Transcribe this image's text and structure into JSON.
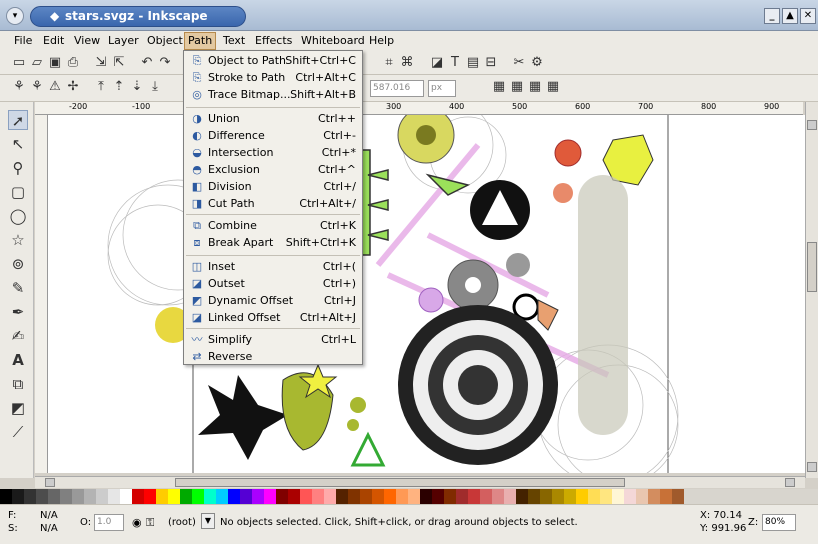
{
  "window": {
    "title": "stars.svgz - Inkscape"
  },
  "menubar": [
    "File",
    "Edit",
    "View",
    "Layer",
    "Object",
    "Path",
    "Text",
    "Effects",
    "Whiteboard",
    "Help"
  ],
  "path_menu": {
    "items": [
      {
        "label": "Object to Path",
        "shortcut": "Shift+Ctrl+C",
        "icon": "object-to-path-icon"
      },
      {
        "label": "Stroke to Path",
        "shortcut": "Ctrl+Alt+C",
        "icon": "stroke-to-path-icon"
      },
      {
        "label": "Trace Bitmap...",
        "shortcut": "Shift+Alt+B",
        "icon": "trace-bitmap-icon"
      },
      {
        "label": "Union",
        "shortcut": "Ctrl++",
        "icon": "union-icon"
      },
      {
        "label": "Difference",
        "shortcut": "Ctrl+-",
        "icon": "difference-icon"
      },
      {
        "label": "Intersection",
        "shortcut": "Ctrl+*",
        "icon": "intersection-icon"
      },
      {
        "label": "Exclusion",
        "shortcut": "Ctrl+^",
        "icon": "exclusion-icon"
      },
      {
        "label": "Division",
        "shortcut": "Ctrl+/",
        "icon": "division-icon"
      },
      {
        "label": "Cut Path",
        "shortcut": "Ctrl+Alt+/",
        "icon": "cut-path-icon"
      },
      {
        "label": "Combine",
        "shortcut": "Ctrl+K",
        "icon": "combine-icon"
      },
      {
        "label": "Break Apart",
        "shortcut": "Shift+Ctrl+K",
        "icon": "break-apart-icon"
      },
      {
        "label": "Inset",
        "shortcut": "Ctrl+(",
        "icon": "inset-icon"
      },
      {
        "label": "Outset",
        "shortcut": "Ctrl+)",
        "icon": "outset-icon"
      },
      {
        "label": "Dynamic Offset",
        "shortcut": "Ctrl+J",
        "icon": "dynamic-offset-icon"
      },
      {
        "label": "Linked Offset",
        "shortcut": "Ctrl+Alt+J",
        "icon": "linked-offset-icon"
      },
      {
        "label": "Simplify",
        "shortcut": "Ctrl+L",
        "icon": "simplify-icon"
      },
      {
        "label": "Reverse",
        "shortcut": "",
        "icon": "reverse-icon"
      }
    ]
  },
  "toolbar2": {
    "w_value": "587.016",
    "unit": "px"
  },
  "ruler": {
    "ticks": [
      "-200",
      "-100",
      "300",
      "400",
      "500",
      "600",
      "700",
      "800",
      "900"
    ]
  },
  "status": {
    "fill_label": "F:",
    "fill_value": "N/A",
    "stroke_label": "S:",
    "stroke_value": "N/A",
    "opacity_label": "O:",
    "opacity_value": "1.0",
    "layer": "(root)",
    "message": "No objects selected. Click, Shift+click, or drag around objects to select.",
    "x_coord": "X: 70.14",
    "y_coord": "Y: 991.96",
    "zoom_label": "Z:",
    "zoom_value": "80%"
  },
  "palette_colors": [
    "#000000",
    "#1a1a1a",
    "#333333",
    "#4d4d4d",
    "#666666",
    "#808080",
    "#999999",
    "#b3b3b3",
    "#cccccc",
    "#e6e6e6",
    "#ffffff",
    "#d40000",
    "#ff0000",
    "#ffcc00",
    "#ffff00",
    "#00aa00",
    "#00ff00",
    "#00ffcc",
    "#00ccff",
    "#0000ff",
    "#5500d4",
    "#aa00ff",
    "#ff00ff",
    "#800000",
    "#aa0000",
    "#ff5555",
    "#ff8080",
    "#ffaaaa",
    "#552200",
    "#803300",
    "#aa4400",
    "#d45500",
    "#ff6600",
    "#ff9955",
    "#ffb380",
    "#2b0000",
    "#550000",
    "#802b00",
    "#a02c2c",
    "#c83737",
    "#d35f5f",
    "#de8787",
    "#e9afaf",
    "#442200",
    "#664400",
    "#886600",
    "#aa8800",
    "#ccaa00",
    "#ffcc00",
    "#ffdd55",
    "#ffe680",
    "#fff6d5",
    "#f4d7d7",
    "#e9c6af",
    "#d38d5f",
    "#c87137",
    "#a05a2c"
  ]
}
